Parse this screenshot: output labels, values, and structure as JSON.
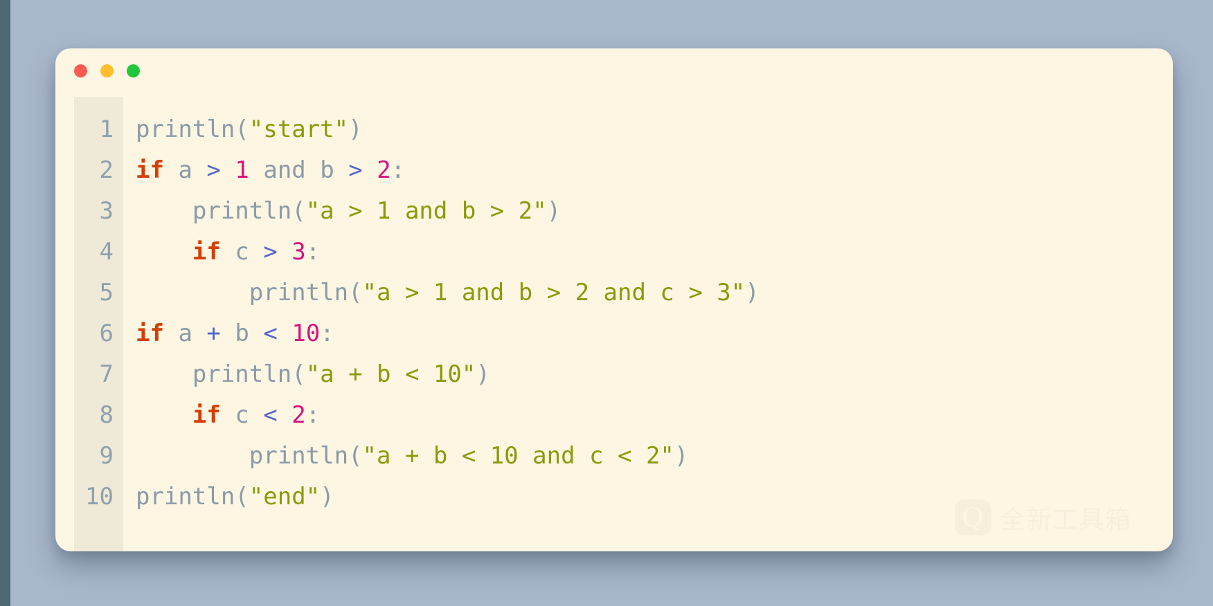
{
  "window": {
    "traffic_lights": [
      {
        "name": "close",
        "color": "#fc5b51"
      },
      {
        "name": "minimize",
        "color": "#ffbd2e"
      },
      {
        "name": "maximize",
        "color": "#22c63c"
      }
    ]
  },
  "theme": {
    "background": "#a9b7cb",
    "left_edge_strip": "#4d6a72",
    "card_background": "#fdf6e3",
    "gutter_background": "#efe9d7",
    "gutter_text": "#8fa1ae",
    "keyword": "#d43e00",
    "identifier": "#8a9ba8",
    "operator": "#5566cc",
    "number": "#d8127d",
    "string": "#8a9a08",
    "punctuation": "#8a9ba8"
  },
  "editor": {
    "line_numbers": [
      "1",
      "2",
      "3",
      "4",
      "5",
      "6",
      "7",
      "8",
      "9",
      "10"
    ],
    "lines": [
      {
        "number": "1",
        "text": "println(\"start\")",
        "tokens": [
          {
            "t": "println",
            "k": "id"
          },
          {
            "t": "(",
            "k": "punc"
          },
          {
            "t": "\"start\"",
            "k": "str"
          },
          {
            "t": ")",
            "k": "punc"
          }
        ]
      },
      {
        "number": "2",
        "text": "if a > 1 and b > 2:",
        "tokens": [
          {
            "t": "if",
            "k": "kw"
          },
          {
            "t": " ",
            "k": "plain"
          },
          {
            "t": "a",
            "k": "id"
          },
          {
            "t": " ",
            "k": "plain"
          },
          {
            "t": ">",
            "k": "op"
          },
          {
            "t": " ",
            "k": "plain"
          },
          {
            "t": "1",
            "k": "num"
          },
          {
            "t": " ",
            "k": "plain"
          },
          {
            "t": "and",
            "k": "id"
          },
          {
            "t": " ",
            "k": "plain"
          },
          {
            "t": "b",
            "k": "id"
          },
          {
            "t": " ",
            "k": "plain"
          },
          {
            "t": ">",
            "k": "op"
          },
          {
            "t": " ",
            "k": "plain"
          },
          {
            "t": "2",
            "k": "num"
          },
          {
            "t": ":",
            "k": "punc"
          }
        ]
      },
      {
        "number": "3",
        "text": "    println(\"a > 1 and b > 2\")",
        "tokens": [
          {
            "t": "    ",
            "k": "plain"
          },
          {
            "t": "println",
            "k": "id"
          },
          {
            "t": "(",
            "k": "punc"
          },
          {
            "t": "\"a > 1 and b > 2\"",
            "k": "str"
          },
          {
            "t": ")",
            "k": "punc"
          }
        ]
      },
      {
        "number": "4",
        "text": "    if c > 3:",
        "tokens": [
          {
            "t": "    ",
            "k": "plain"
          },
          {
            "t": "if",
            "k": "kw"
          },
          {
            "t": " ",
            "k": "plain"
          },
          {
            "t": "c",
            "k": "id"
          },
          {
            "t": " ",
            "k": "plain"
          },
          {
            "t": ">",
            "k": "op"
          },
          {
            "t": " ",
            "k": "plain"
          },
          {
            "t": "3",
            "k": "num"
          },
          {
            "t": ":",
            "k": "punc"
          }
        ]
      },
      {
        "number": "5",
        "text": "        println(\"a > 1 and b > 2 and c > 3\")",
        "tokens": [
          {
            "t": "        ",
            "k": "plain"
          },
          {
            "t": "println",
            "k": "id"
          },
          {
            "t": "(",
            "k": "punc"
          },
          {
            "t": "\"a > 1 and b > 2 and c > 3\"",
            "k": "str"
          },
          {
            "t": ")",
            "k": "punc"
          }
        ]
      },
      {
        "number": "6",
        "text": "if a + b < 10:",
        "tokens": [
          {
            "t": "if",
            "k": "kw"
          },
          {
            "t": " ",
            "k": "plain"
          },
          {
            "t": "a",
            "k": "id"
          },
          {
            "t": " ",
            "k": "plain"
          },
          {
            "t": "+",
            "k": "op"
          },
          {
            "t": " ",
            "k": "plain"
          },
          {
            "t": "b",
            "k": "id"
          },
          {
            "t": " ",
            "k": "plain"
          },
          {
            "t": "<",
            "k": "op"
          },
          {
            "t": " ",
            "k": "plain"
          },
          {
            "t": "10",
            "k": "num"
          },
          {
            "t": ":",
            "k": "punc"
          }
        ]
      },
      {
        "number": "7",
        "text": "    println(\"a + b < 10\")",
        "tokens": [
          {
            "t": "    ",
            "k": "plain"
          },
          {
            "t": "println",
            "k": "id"
          },
          {
            "t": "(",
            "k": "punc"
          },
          {
            "t": "\"a + b < 10\"",
            "k": "str"
          },
          {
            "t": ")",
            "k": "punc"
          }
        ]
      },
      {
        "number": "8",
        "text": "    if c < 2:",
        "tokens": [
          {
            "t": "    ",
            "k": "plain"
          },
          {
            "t": "if",
            "k": "kw"
          },
          {
            "t": " ",
            "k": "plain"
          },
          {
            "t": "c",
            "k": "id"
          },
          {
            "t": " ",
            "k": "plain"
          },
          {
            "t": "<",
            "k": "op"
          },
          {
            "t": " ",
            "k": "plain"
          },
          {
            "t": "2",
            "k": "num"
          },
          {
            "t": ":",
            "k": "punc"
          }
        ]
      },
      {
        "number": "9",
        "text": "        println(\"a + b < 10 and c < 2\")",
        "tokens": [
          {
            "t": "        ",
            "k": "plain"
          },
          {
            "t": "println",
            "k": "id"
          },
          {
            "t": "(",
            "k": "punc"
          },
          {
            "t": "\"a + b < 10 and c < 2\"",
            "k": "str"
          },
          {
            "t": ")",
            "k": "punc"
          }
        ]
      },
      {
        "number": "10",
        "text": "println(\"end\")",
        "tokens": [
          {
            "t": "println",
            "k": "id"
          },
          {
            "t": "(",
            "k": "punc"
          },
          {
            "t": "\"end\"",
            "k": "str"
          },
          {
            "t": ")",
            "k": "punc"
          }
        ]
      }
    ]
  },
  "watermark": {
    "logo_letter": "Q",
    "text": "全新工具箱"
  }
}
